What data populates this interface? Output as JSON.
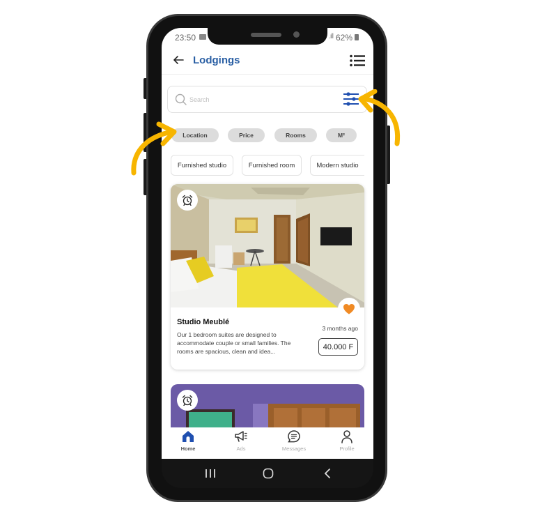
{
  "status_bar": {
    "time": "23:50",
    "signal": ".ıll",
    "battery": "62%"
  },
  "header": {
    "title": "Lodgings",
    "back_icon": "arrow-left-icon",
    "menu_icon": "list-menu-icon"
  },
  "search": {
    "placeholder": "Search",
    "value": "",
    "filter_icon": "sliders-icon"
  },
  "filter_chips": [
    {
      "label": "Location"
    },
    {
      "label": "Price"
    },
    {
      "label": "Rooms"
    },
    {
      "label": "M²"
    }
  ],
  "category_tags": [
    {
      "label": "Furnished studio"
    },
    {
      "label": "Furnished room"
    },
    {
      "label": "Modern studio"
    }
  ],
  "listings": [
    {
      "title": "Studio Meublé",
      "description": "Our 1 bedroom suites are designed to accommodate couple or small families. The rooms are spacious, clean and idea...",
      "posted": "3 months ago",
      "price": "40.000 F",
      "favorite": true
    },
    {
      "title": "",
      "favorite": false
    }
  ],
  "bottom_nav": [
    {
      "label": "Home",
      "icon": "home-icon",
      "active": true
    },
    {
      "label": "Ads",
      "icon": "megaphone-icon",
      "active": false
    },
    {
      "label": "Messages",
      "icon": "message-icon",
      "active": false
    },
    {
      "label": "Profile",
      "icon": "user-icon",
      "active": false
    }
  ],
  "colors": {
    "accent": "#2a5fa4",
    "icon_blue": "#1f4fb0",
    "favorite": "#f08a24",
    "annotation_arrow": "#f7b500",
    "chip_bg": "#dcdcdc"
  }
}
